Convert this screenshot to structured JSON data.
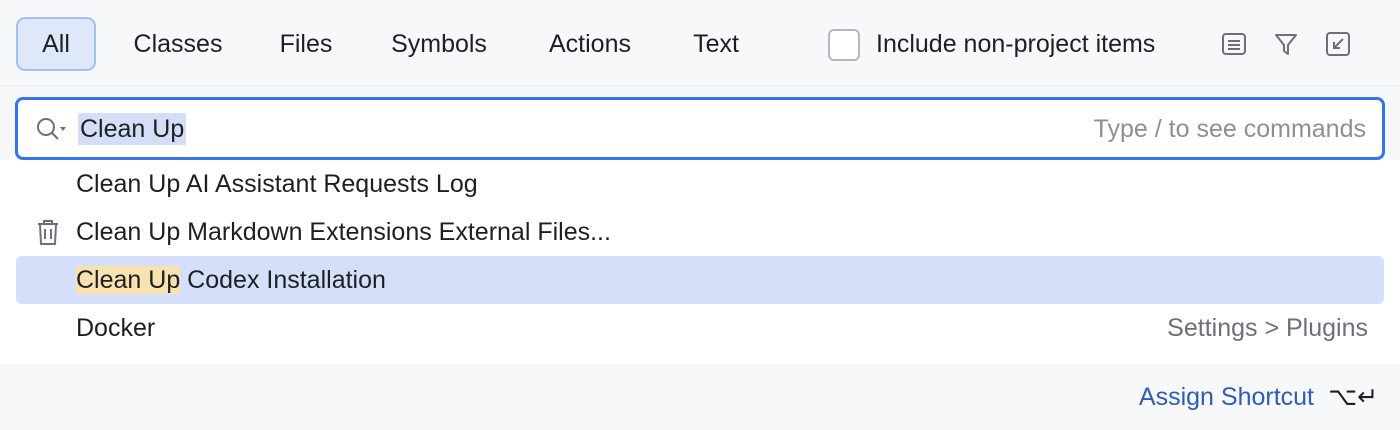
{
  "tabs": [
    {
      "label": "All",
      "active": true
    },
    {
      "label": "Classes",
      "active": false
    },
    {
      "label": "Files",
      "active": false
    },
    {
      "label": "Symbols",
      "active": false
    },
    {
      "label": "Actions",
      "active": false
    },
    {
      "label": "Text",
      "active": false
    }
  ],
  "options": {
    "include_non_project_label": "Include non-project items",
    "include_non_project_checked": false,
    "icons": [
      "preview-icon",
      "filter-icon",
      "collapse-to-tool-window-icon"
    ]
  },
  "search": {
    "value": "Clean Up",
    "hint": "Type / to see commands",
    "icon": "search-with-options-icon"
  },
  "results": [
    {
      "prefix": "",
      "text": "Clean Up AI Assistant Requests Log",
      "hint": "",
      "icon": "",
      "selected": false
    },
    {
      "prefix": "",
      "text": "Clean Up Markdown Extensions External Files...",
      "hint": "",
      "icon": "trash-icon",
      "selected": false
    },
    {
      "prefix": "Clean Up",
      "text": " Codex Installation",
      "hint": "",
      "icon": "",
      "selected": true
    },
    {
      "prefix": "",
      "text": "Docker",
      "hint": "Settings > Plugins",
      "icon": "",
      "selected": false
    }
  ],
  "footer": {
    "assign_shortcut_label": "Assign Shortcut",
    "shortcut_keys": "⌥↵"
  },
  "colors": {
    "accent": "#3574f0",
    "selection": "#d4e0f9",
    "match_highlight": "#f8e3b0",
    "link": "#2f5cb6"
  }
}
